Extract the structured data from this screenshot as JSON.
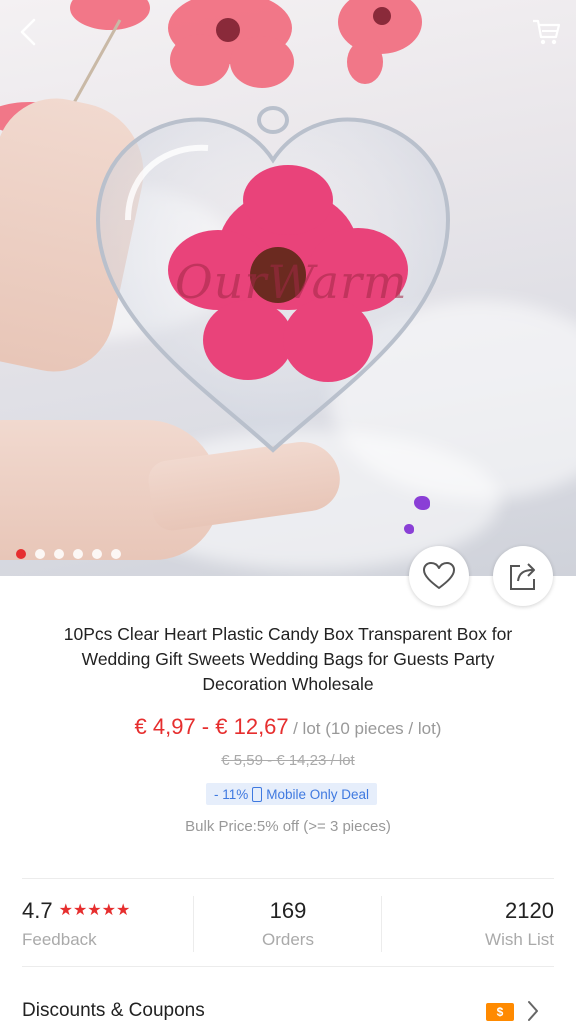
{
  "header": {
    "back_icon": "chevron-left-icon",
    "cart_icon": "cart-icon"
  },
  "gallery": {
    "watermark": "OurWarm",
    "image_count": 6,
    "active_index": 0
  },
  "actions": {
    "wishlist_icon": "heart-outline-icon",
    "share_icon": "share-icon"
  },
  "product": {
    "title": "10Pcs Clear Heart Plastic Candy Box Transparent Box for Wedding Gift Sweets Wedding Bags for Guests Party Decoration Wholesale",
    "price": "€ 4,97 - € 12,67",
    "price_unit": "/ lot (10 pieces / lot)",
    "original_price": "€ 5,59 - € 14,23 / lot",
    "discount": "- 11%",
    "deal_label": "Mobile Only Deal",
    "bulk_price": "Bulk Price:5% off (>= 3 pieces)"
  },
  "stats": {
    "rating": "4.7",
    "rating_stars": "★★★★★",
    "feedback_label": "Feedback",
    "orders": "169",
    "orders_label": "Orders",
    "wishlist": "2120",
    "wishlist_label": "Wish List"
  },
  "coupons": {
    "label": "Discounts & Coupons",
    "badge": "$"
  },
  "colors": {
    "accent": "#e62e2e",
    "deal_blue": "#3f79e0",
    "coupon_orange": "#ff8a00",
    "muted": "#999999"
  }
}
